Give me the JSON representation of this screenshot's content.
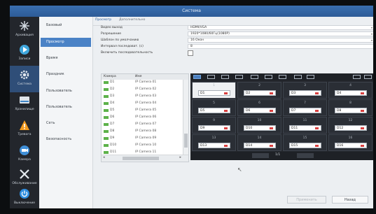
{
  "window": {
    "title": "Система"
  },
  "sidebar": {
    "items": [
      {
        "label": "Архивация"
      },
      {
        "label": "Записи"
      },
      {
        "label": "Система"
      },
      {
        "label": "Хранилище"
      },
      {
        "label": "Тревога"
      },
      {
        "label": "Камера"
      },
      {
        "label": "Обслуживание"
      },
      {
        "label": "Выключение"
      }
    ]
  },
  "submenu": {
    "items": [
      {
        "label": "Базовый"
      },
      {
        "label": "Просмотр"
      },
      {
        "label": "Время"
      },
      {
        "label": "Праздник"
      },
      {
        "label": "Пользователь"
      },
      {
        "label": "Пользователь"
      },
      {
        "label": "Сеть"
      },
      {
        "label": "Безопасность"
      }
    ]
  },
  "tabs": [
    {
      "label": "Просмотр"
    },
    {
      "label": "Дополнительно"
    }
  ],
  "form": {
    "rows": [
      {
        "label": "Видео выход",
        "value": "HDMI/VGA"
      },
      {
        "label": "Разрешение",
        "value": "1920*1080/60Гц(1080P)"
      },
      {
        "label": "Шаблон по умолчанию",
        "value": "16 Окон"
      },
      {
        "label": "Интервал последоват. (с)",
        "value": "8"
      },
      {
        "label": "Включить последовательность"
      }
    ]
  },
  "camera_list": {
    "headers": [
      "Камера",
      "Имя"
    ],
    "rows": [
      {
        "id": "D1",
        "name": "IP Camera 01"
      },
      {
        "id": "D2",
        "name": "IP Camera 02"
      },
      {
        "id": "D3",
        "name": "IP Camera 03"
      },
      {
        "id": "D4",
        "name": "IP Camera 04"
      },
      {
        "id": "D5",
        "name": "IP Camera 05"
      },
      {
        "id": "D6",
        "name": "IP Camera 06"
      },
      {
        "id": "D7",
        "name": "IP Camera 07"
      },
      {
        "id": "D8",
        "name": "IP Camera 08"
      },
      {
        "id": "D9",
        "name": "IP Camera 09"
      },
      {
        "id": "D10",
        "name": "IP Camera 10"
      },
      {
        "id": "D11",
        "name": "IP Camera 11"
      }
    ]
  },
  "grid": {
    "cells": [
      {
        "num": "1",
        "cam": "D1"
      },
      {
        "num": "2",
        "cam": "D2"
      },
      {
        "num": "3",
        "cam": "D3"
      },
      {
        "num": "4",
        "cam": "D4"
      },
      {
        "num": "5",
        "cam": "D5"
      },
      {
        "num": "6",
        "cam": "D6"
      },
      {
        "num": "7",
        "cam": "D7"
      },
      {
        "num": "8",
        "cam": "D8"
      },
      {
        "num": "9",
        "cam": "D9"
      },
      {
        "num": "10",
        "cam": "D10"
      },
      {
        "num": "11",
        "cam": "D11"
      },
      {
        "num": "12",
        "cam": "D12"
      },
      {
        "num": "13",
        "cam": "D13"
      },
      {
        "num": "14",
        "cam": "D14"
      },
      {
        "num": "15",
        "cam": "D15"
      },
      {
        "num": "16",
        "cam": "D16"
      }
    ],
    "page": "1/1"
  },
  "buttons": {
    "apply": "Применить",
    "back": "Назад"
  },
  "colors": {
    "accent": "#4a82c6",
    "titlebar": "#2d5b97",
    "sidebar": "#23262c"
  }
}
